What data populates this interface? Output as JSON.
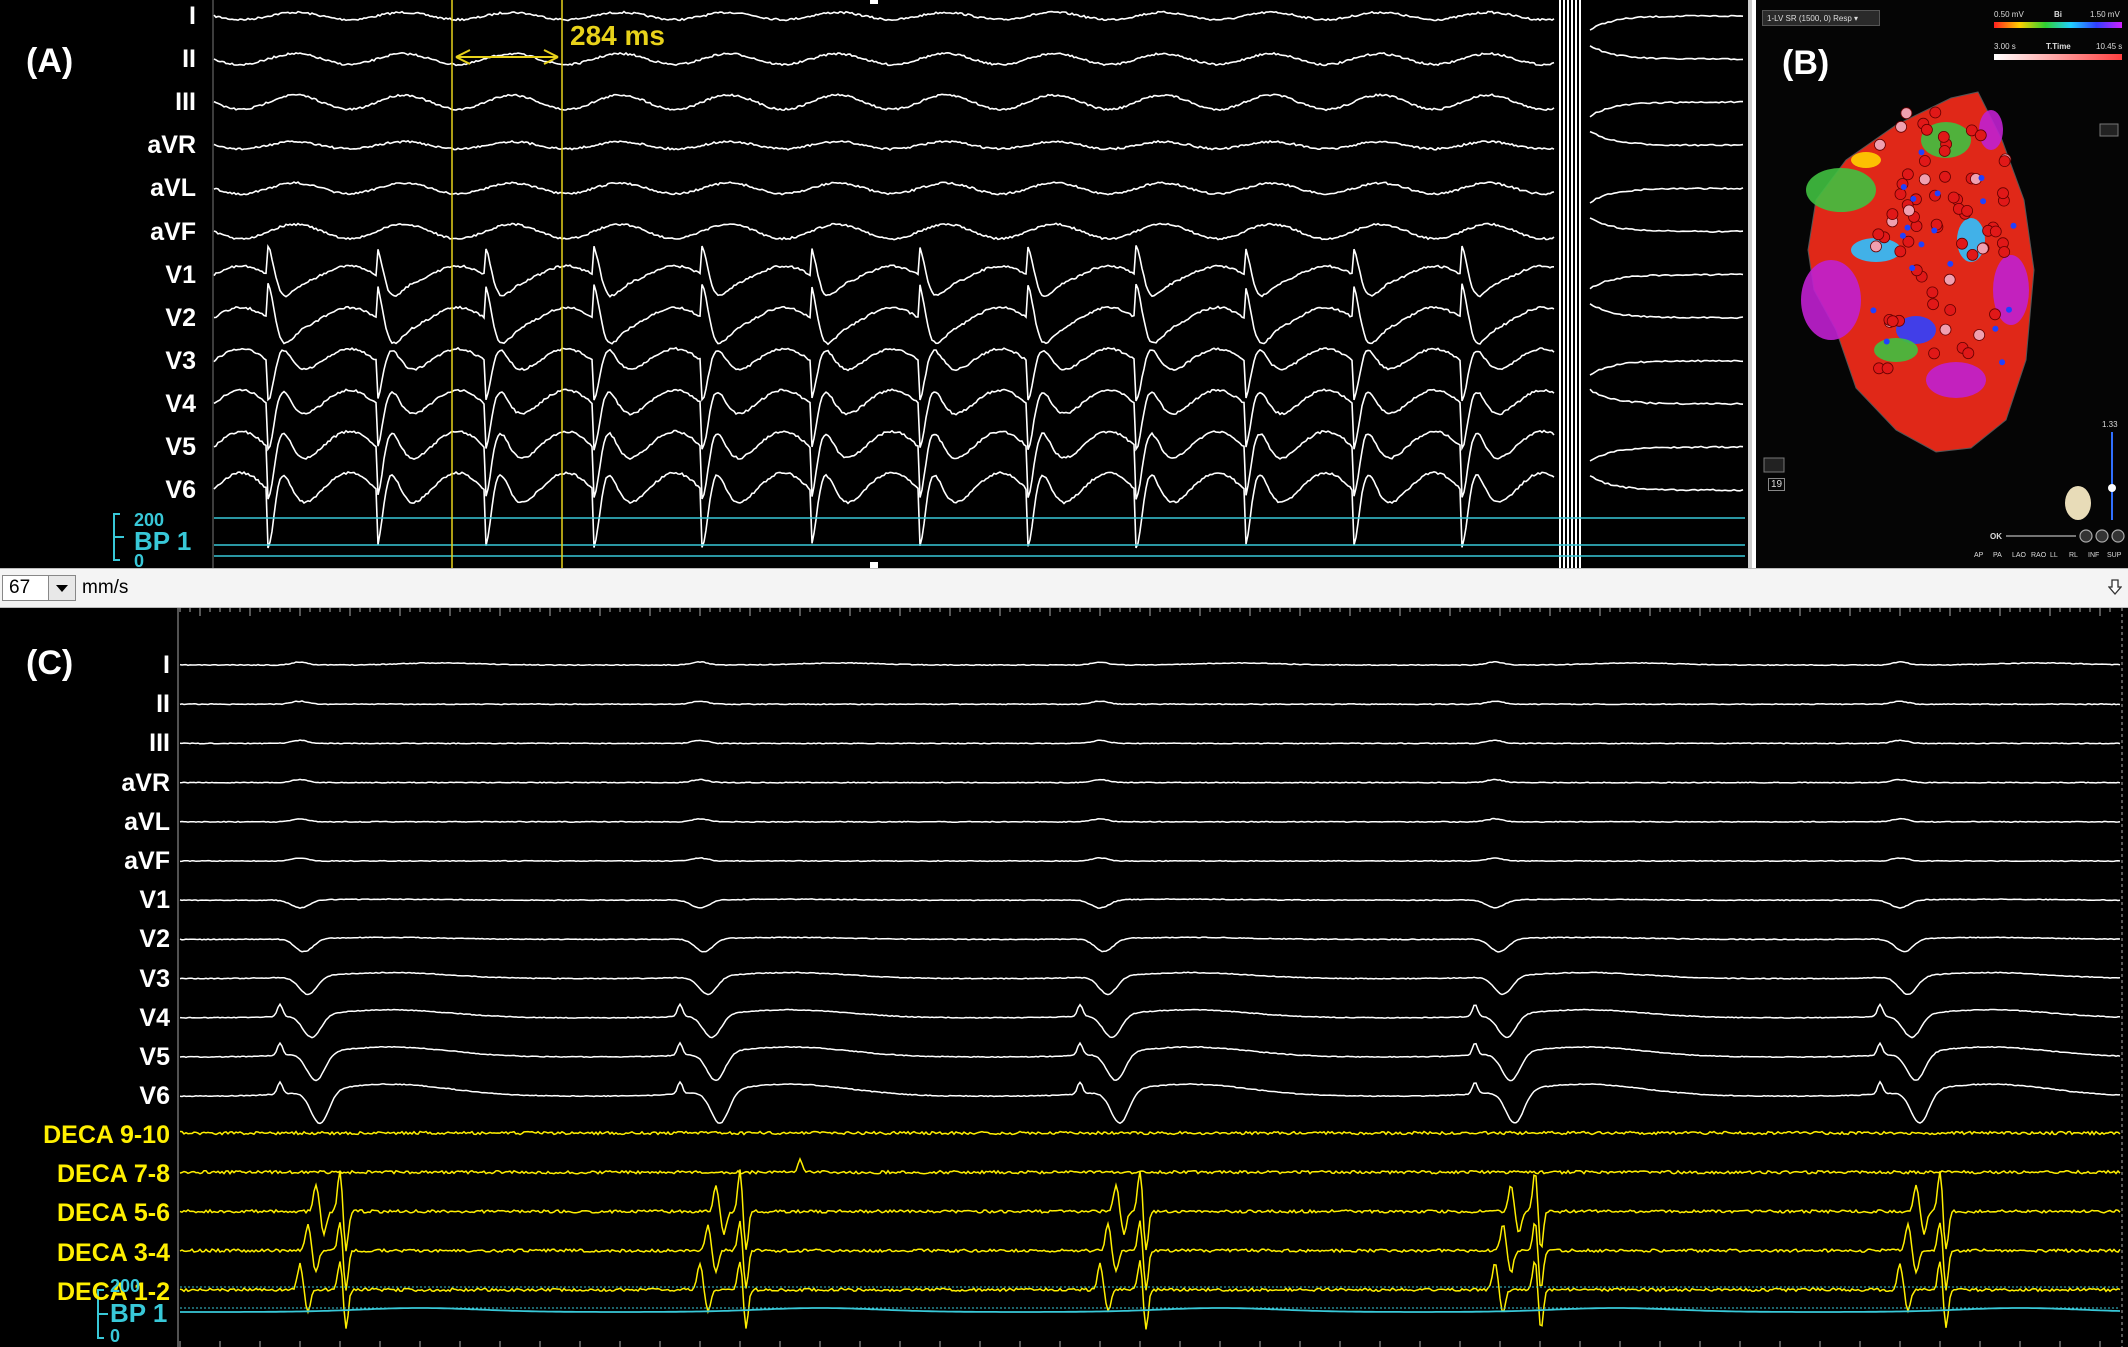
{
  "panelA": {
    "label": "(A)",
    "leads": [
      "I",
      "II",
      "III",
      "aVR",
      "aVL",
      "aVF",
      "V1",
      "V2",
      "V3",
      "V4",
      "V5",
      "V6"
    ],
    "measurement": "284 ms",
    "bp": {
      "name": "BP 1",
      "max": "200",
      "min": "0"
    }
  },
  "panelB": {
    "label": "(B)",
    "map_name": "1-LV SR (1500, 0) Resp",
    "voltage_min": "0.50 mV",
    "voltage_mode": "Bi",
    "voltage_max": "1.50 mV",
    "time_min": "3.00 s",
    "time_mode": "T.Time",
    "time_max": "10.45 s",
    "scale_value": "1.33",
    "count": "19",
    "ok_label": "OK",
    "views": [
      "AP",
      "PA",
      "LAO",
      "RAO",
      "LL",
      "RL",
      "INF",
      "SUP"
    ]
  },
  "speedbar": {
    "speed": "67",
    "unit": "mm/s"
  },
  "panelC": {
    "label": "(C)",
    "leads": [
      "I",
      "II",
      "III",
      "aVR",
      "aVL",
      "aVF",
      "V1",
      "V2",
      "V3",
      "V4",
      "V5",
      "V6"
    ],
    "deca": [
      "DECA 9-10",
      "DECA 7-8",
      "DECA 5-6",
      "DECA 3-4",
      "DECA 1-2"
    ],
    "bp": {
      "name": "BP 1",
      "max": "200",
      "min": "0"
    }
  },
  "colors": {
    "trace": "#ffffff",
    "deca": "#ffef00",
    "bp": "#38c8d8",
    "caliper": "#e8d21a"
  }
}
